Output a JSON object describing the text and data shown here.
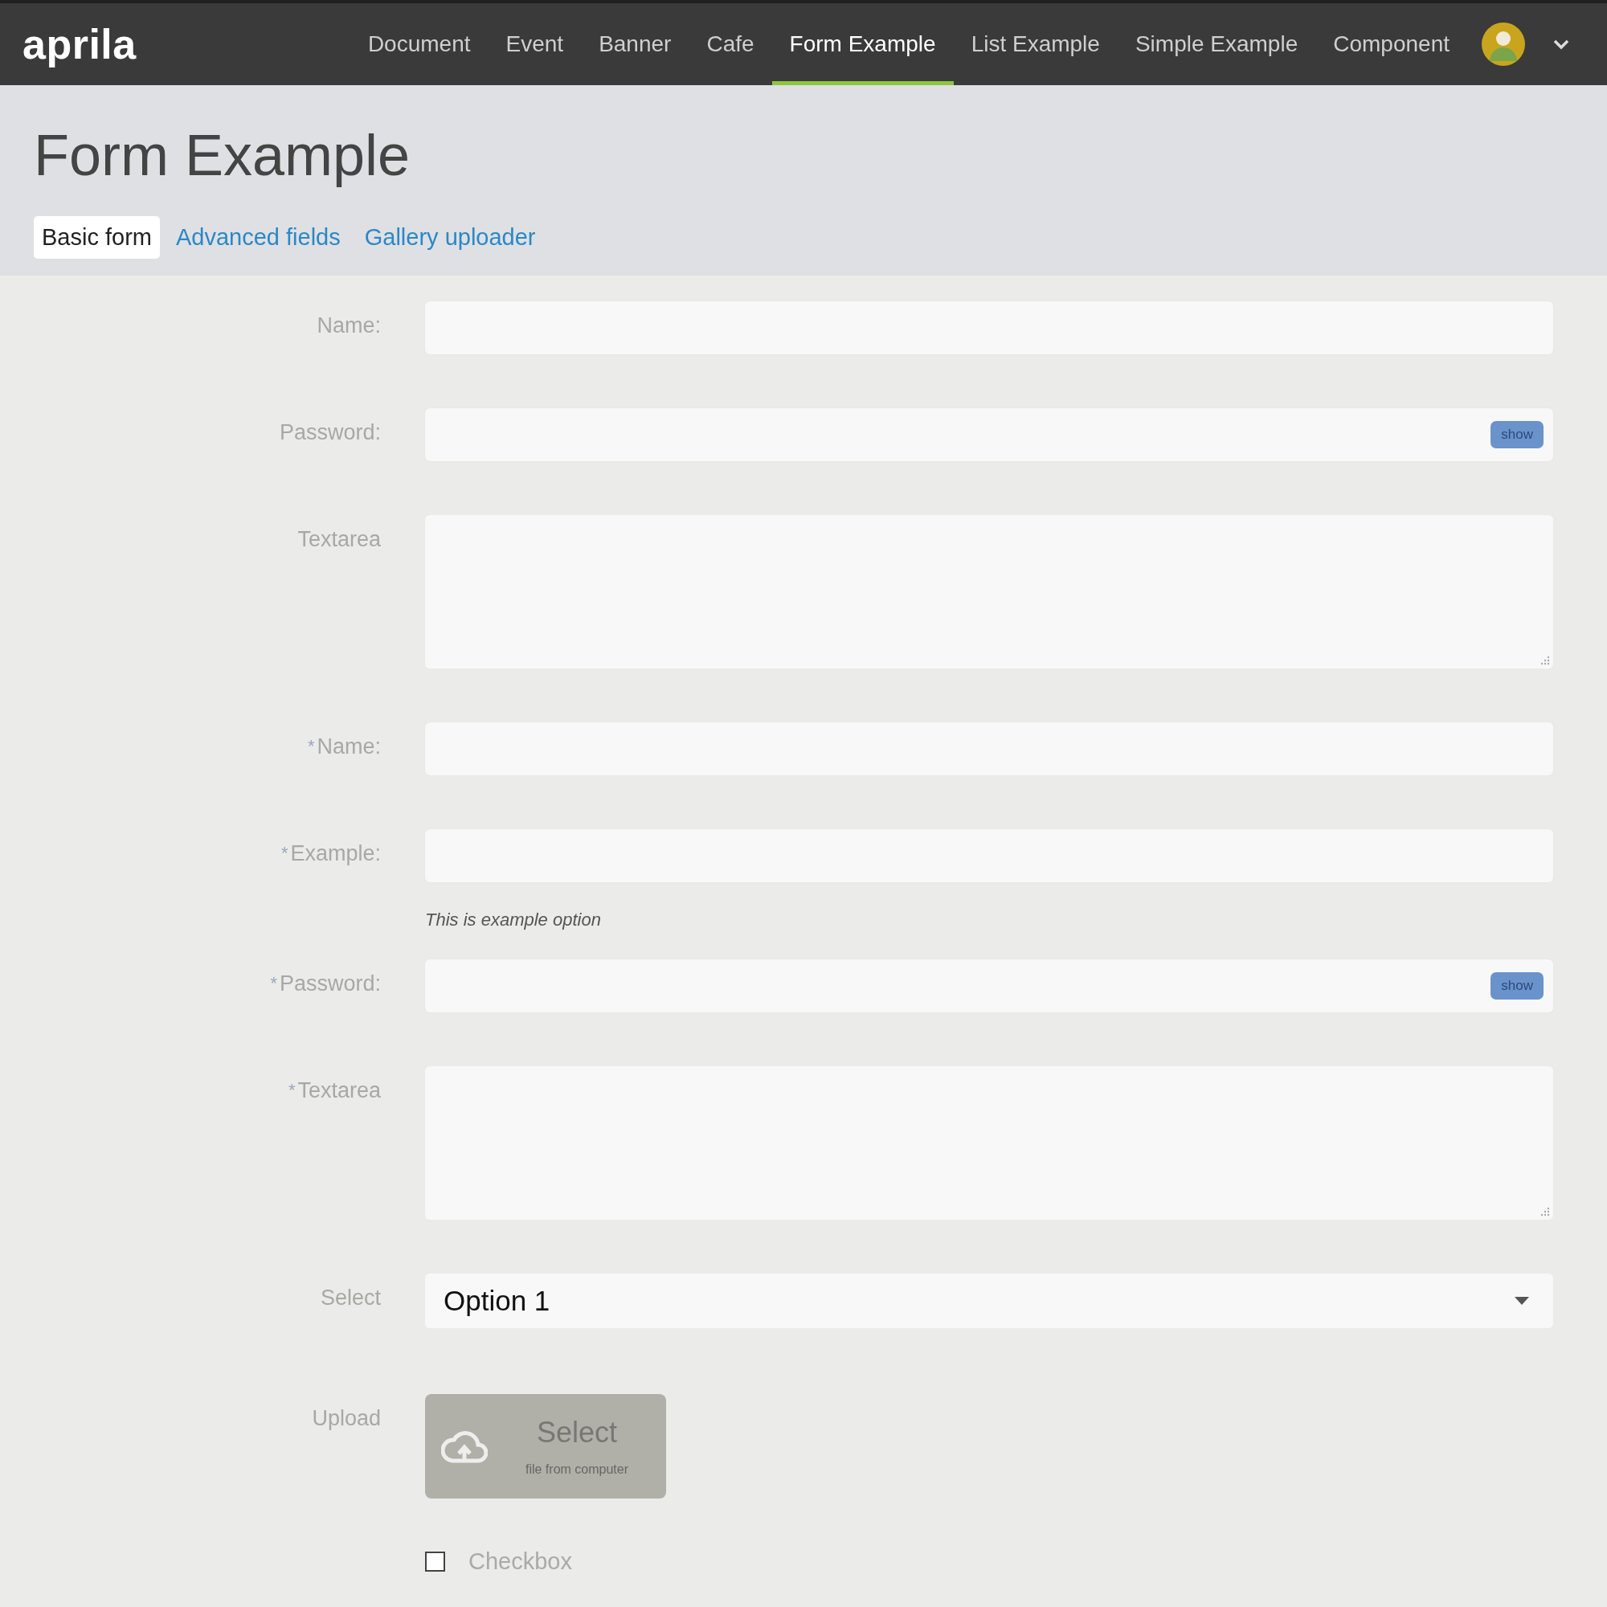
{
  "header": {
    "logo": "aprila",
    "nav": [
      {
        "label": "Document",
        "selected": false
      },
      {
        "label": "Event",
        "selected": false
      },
      {
        "label": "Banner",
        "selected": false
      },
      {
        "label": "Cafe",
        "selected": false
      },
      {
        "label": "Form Example",
        "selected": true
      },
      {
        "label": "List Example",
        "selected": false
      },
      {
        "label": "Simple Example",
        "selected": false
      },
      {
        "label": "Component",
        "selected": false
      }
    ]
  },
  "page": {
    "title": "Form Example",
    "tabs": [
      {
        "label": "Basic form",
        "selected": true
      },
      {
        "label": "Advanced fields",
        "selected": false
      },
      {
        "label": "Gallery uploader",
        "selected": false
      }
    ]
  },
  "form": {
    "fields": [
      {
        "kind": "text",
        "label": "Name:"
      },
      {
        "kind": "password",
        "label": "Password:",
        "toggle": "show"
      },
      {
        "kind": "textarea",
        "label": "Textarea"
      },
      {
        "kind": "text",
        "label": "Name:",
        "marker": "*"
      },
      {
        "kind": "text",
        "label": "Example:",
        "marker": "*",
        "help": "This is example option"
      },
      {
        "kind": "password",
        "label": "Password:",
        "marker": "*",
        "toggle": "show"
      },
      {
        "kind": "textarea",
        "label": "Textarea",
        "marker": "*"
      },
      {
        "kind": "select",
        "label": "Select",
        "value": "Option 1"
      },
      {
        "kind": "upload",
        "label": "Upload",
        "button": "Select",
        "hint": "file from computer"
      },
      {
        "kind": "checkbox",
        "label": "Checkbox",
        "checked": false
      }
    ]
  }
}
